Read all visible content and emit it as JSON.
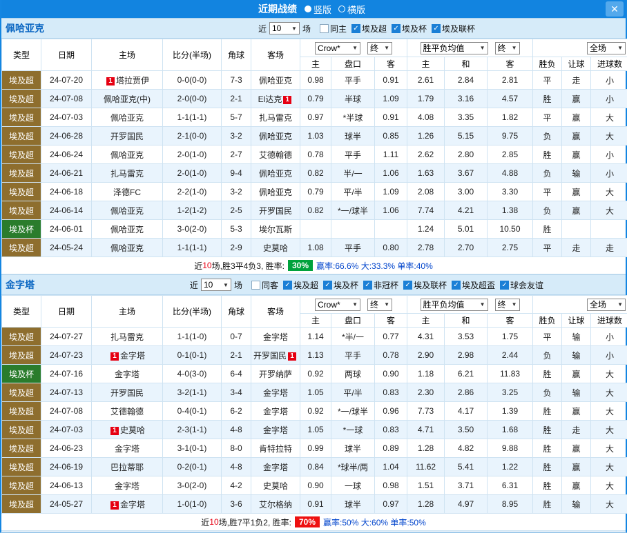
{
  "titlebar": {
    "title": "近期战绩",
    "radios": [
      {
        "label": "竖版",
        "selected": true
      },
      {
        "label": "横版",
        "selected": false
      }
    ],
    "close": "✕"
  },
  "controls": {
    "near": "近",
    "count": "10",
    "games": "场",
    "bookmaker": "Crow*",
    "final": "终",
    "avg": "胜平负均值",
    "scope": "全场"
  },
  "columns": {
    "type": "类型",
    "date": "日期",
    "home": "主场",
    "score": "比分(半场)",
    "corner": "角球",
    "away": "客场",
    "h": "主",
    "handicap": "盘口",
    "a": "客",
    "w": "主",
    "d": "和",
    "l": "客",
    "wl": "胜负",
    "let": "让球",
    "goals": "进球数"
  },
  "colors": {
    "win": "#e60012",
    "lose": "#009933",
    "draw": "#0033cc",
    "league_super": "#8e6e2e",
    "league_cup": "#2a7c2c",
    "titlebar": "#1284e0",
    "band": "#d6ebf9",
    "alt_row": "#e9f4fd"
  },
  "sections": [
    {
      "team": "佩哈亚克",
      "filters": {
        "checkboxes": [
          {
            "label": "同主",
            "checked": false
          },
          {
            "label": "埃及超",
            "checked": true
          },
          {
            "label": "埃及杯",
            "checked": true
          },
          {
            "label": "埃及联杯",
            "checked": true
          }
        ]
      },
      "rows": [
        {
          "type": "埃及超",
          "date": "24-07-20",
          "home": "塔拉贾伊",
          "home_badge": "1",
          "score": "0-0(0-0)",
          "corner": "7-3",
          "away": "佩哈亚克",
          "o_h": "0.98",
          "o_hc": "平手",
          "o_a": "0.91",
          "w": "2.61",
          "d": "2.84",
          "l": "2.81",
          "res": "平",
          "let": "走",
          "goal": "小"
        },
        {
          "type": "埃及超",
          "date": "24-07-08",
          "home": "佩哈亚克(中)",
          "score": "2-0(0-0)",
          "corner": "2-1",
          "away": "El达克",
          "away_badge": "1",
          "o_h": "0.79",
          "o_hc": "半球",
          "o_a": "1.09",
          "w": "1.79",
          "d": "3.16",
          "l": "4.57",
          "res": "胜",
          "let": "赢",
          "goal": "小"
        },
        {
          "type": "埃及超",
          "date": "24-07-03",
          "home": "佩哈亚克",
          "score": "1-1(1-1)",
          "corner": "5-7",
          "away": "扎马雷克",
          "o_h": "0.97",
          "o_hc": "*半球",
          "o_a": "0.91",
          "w": "4.08",
          "d": "3.35",
          "l": "1.82",
          "res": "平",
          "let": "赢",
          "goal": "大"
        },
        {
          "type": "埃及超",
          "date": "24-06-28",
          "home": "开罗国民",
          "score": "2-1(0-0)",
          "corner": "3-2",
          "away": "佩哈亚克",
          "o_h": "1.03",
          "o_hc": "球半",
          "o_a": "0.85",
          "w": "1.26",
          "d": "5.15",
          "l": "9.75",
          "res": "负",
          "let": "赢",
          "goal": "大"
        },
        {
          "type": "埃及超",
          "date": "24-06-24",
          "home": "佩哈亚克",
          "score": "2-0(1-0)",
          "corner": "2-7",
          "away": "艾德翰德",
          "o_h": "0.78",
          "o_hc": "平手",
          "o_a": "1.11",
          "w": "2.62",
          "d": "2.80",
          "l": "2.85",
          "res": "胜",
          "let": "赢",
          "goal": "小"
        },
        {
          "type": "埃及超",
          "date": "24-06-21",
          "home": "扎马雷克",
          "score": "2-0(1-0)",
          "corner": "9-4",
          "away": "佩哈亚克",
          "o_h": "0.82",
          "o_hc": "半/一",
          "o_a": "1.06",
          "w": "1.63",
          "d": "3.67",
          "l": "4.88",
          "res": "负",
          "let": "输",
          "goal": "小"
        },
        {
          "type": "埃及超",
          "date": "24-06-18",
          "home": "泽德FC",
          "score": "2-2(1-0)",
          "corner": "3-2",
          "away": "佩哈亚克",
          "o_h": "0.79",
          "o_hc": "平/半",
          "o_a": "1.09",
          "w": "2.08",
          "d": "3.00",
          "l": "3.30",
          "res": "平",
          "let": "赢",
          "goal": "大"
        },
        {
          "type": "埃及超",
          "date": "24-06-14",
          "home": "佩哈亚克",
          "score": "1-2(1-2)",
          "corner": "2-5",
          "away": "开罗国民",
          "o_h": "0.82",
          "o_hc": "*一/球半",
          "o_a": "1.06",
          "w": "7.74",
          "d": "4.21",
          "l": "1.38",
          "res": "负",
          "let": "赢",
          "goal": "大"
        },
        {
          "type": "埃及杯",
          "date": "24-06-01",
          "home": "佩哈亚克",
          "score": "3-0(2-0)",
          "corner": "5-3",
          "away": "埃尔瓦斯",
          "o_h": "",
          "o_hc": "",
          "o_a": "",
          "w": "1.24",
          "d": "5.01",
          "l": "10.50",
          "res": "胜",
          "let": "",
          "goal": ""
        },
        {
          "type": "埃及超",
          "date": "24-05-24",
          "home": "佩哈亚克",
          "score": "1-1(1-1)",
          "corner": "2-9",
          "away": "史莫哈",
          "o_h": "1.08",
          "o_hc": "平手",
          "o_a": "0.80",
          "w": "2.78",
          "d": "2.70",
          "l": "2.75",
          "res": "平",
          "let": "走",
          "goal": "走"
        }
      ],
      "summary": {
        "prefix": "近",
        "count": "10",
        "mid": "场,胜3平4负3, 胜率:",
        "rate": "30%",
        "rate_color": "green",
        "tail": "赢率:66.6% 大:33.3% 单率:40%"
      }
    },
    {
      "team": "金字塔",
      "filters": {
        "checkboxes": [
          {
            "label": "同客",
            "checked": false
          },
          {
            "label": "埃及超",
            "checked": true
          },
          {
            "label": "埃及杯",
            "checked": true
          },
          {
            "label": "非冠杯",
            "checked": true
          },
          {
            "label": "埃及联杯",
            "checked": true
          },
          {
            "label": "埃及超盃",
            "checked": true
          },
          {
            "label": "球会友谊",
            "checked": true
          }
        ]
      },
      "rows": [
        {
          "type": "埃及超",
          "date": "24-07-27",
          "home": "扎马雷克",
          "score": "1-1(1-0)",
          "corner": "0-7",
          "away": "金字塔",
          "o_h": "1.14",
          "o_hc": "*半/一",
          "o_a": "0.77",
          "w": "4.31",
          "d": "3.53",
          "l": "1.75",
          "res": "平",
          "let": "输",
          "goal": "小"
        },
        {
          "type": "埃及超",
          "date": "24-07-23",
          "home": "金字塔",
          "home_badge": "1",
          "score": "0-1(0-1)",
          "corner": "2-1",
          "away": "开罗国民",
          "away_badge": "1",
          "o_h": "1.13",
          "o_hc": "平手",
          "o_a": "0.78",
          "w": "2.90",
          "d": "2.98",
          "l": "2.44",
          "res": "负",
          "let": "输",
          "goal": "小"
        },
        {
          "type": "埃及杯",
          "date": "24-07-16",
          "home": "金字塔",
          "score": "4-0(3-0)",
          "corner": "6-4",
          "away": "开罗纳萨",
          "o_h": "0.92",
          "o_hc": "两球",
          "o_a": "0.90",
          "w": "1.18",
          "d": "6.21",
          "l": "11.83",
          "res": "胜",
          "let": "赢",
          "goal": "大"
        },
        {
          "type": "埃及超",
          "date": "24-07-13",
          "home": "开罗国民",
          "score": "3-2(1-1)",
          "corner": "3-4",
          "away": "金字塔",
          "o_h": "1.05",
          "o_hc": "平/半",
          "o_a": "0.83",
          "w": "2.30",
          "d": "2.86",
          "l": "3.25",
          "res": "负",
          "let": "输",
          "goal": "大"
        },
        {
          "type": "埃及超",
          "date": "24-07-08",
          "home": "艾德翰德",
          "score": "0-4(0-1)",
          "corner": "6-2",
          "away": "金字塔",
          "o_h": "0.92",
          "o_hc": "*一/球半",
          "o_a": "0.96",
          "w": "7.73",
          "d": "4.17",
          "l": "1.39",
          "res": "胜",
          "let": "赢",
          "goal": "大"
        },
        {
          "type": "埃及超",
          "date": "24-07-03",
          "home": "史莫哈",
          "home_badge": "1",
          "score": "2-3(1-1)",
          "corner": "4-8",
          "away": "金字塔",
          "o_h": "1.05",
          "o_hc": "*一球",
          "o_a": "0.83",
          "w": "4.71",
          "d": "3.50",
          "l": "1.68",
          "res": "胜",
          "let": "走",
          "goal": "大"
        },
        {
          "type": "埃及超",
          "date": "24-06-23",
          "home": "金字塔",
          "score": "3-1(0-1)",
          "corner": "8-0",
          "away": "肯特拉特",
          "o_h": "0.99",
          "o_hc": "球半",
          "o_a": "0.89",
          "w": "1.28",
          "d": "4.82",
          "l": "9.88",
          "res": "胜",
          "let": "赢",
          "goal": "大"
        },
        {
          "type": "埃及超",
          "date": "24-06-19",
          "home": "巴拉蒂耶",
          "score": "0-2(0-1)",
          "corner": "4-8",
          "away": "金字塔",
          "o_h": "0.84",
          "o_hc": "*球半/两",
          "o_a": "1.04",
          "w": "11.62",
          "d": "5.41",
          "l": "1.22",
          "res": "胜",
          "let": "赢",
          "goal": "大"
        },
        {
          "type": "埃及超",
          "date": "24-06-13",
          "home": "金字塔",
          "score": "3-0(2-0)",
          "corner": "4-2",
          "away": "史莫哈",
          "o_h": "0.90",
          "o_hc": "一球",
          "o_a": "0.98",
          "w": "1.51",
          "d": "3.71",
          "l": "6.31",
          "res": "胜",
          "let": "赢",
          "goal": "大"
        },
        {
          "type": "埃及超",
          "date": "24-05-27",
          "home": "金字塔",
          "home_badge": "1",
          "score": "1-0(1-0)",
          "corner": "3-6",
          "away": "艾尔格纳",
          "o_h": "0.91",
          "o_hc": "球半",
          "o_a": "0.97",
          "w": "1.28",
          "d": "4.97",
          "l": "8.95",
          "res": "胜",
          "let": "输",
          "goal": "大"
        }
      ],
      "summary": {
        "prefix": "近",
        "count": "10",
        "mid": "场,胜7平1负2, 胜率:",
        "rate": "70%",
        "rate_color": "red",
        "tail": "赢率:50% 大:60% 单率:50%"
      }
    }
  ]
}
